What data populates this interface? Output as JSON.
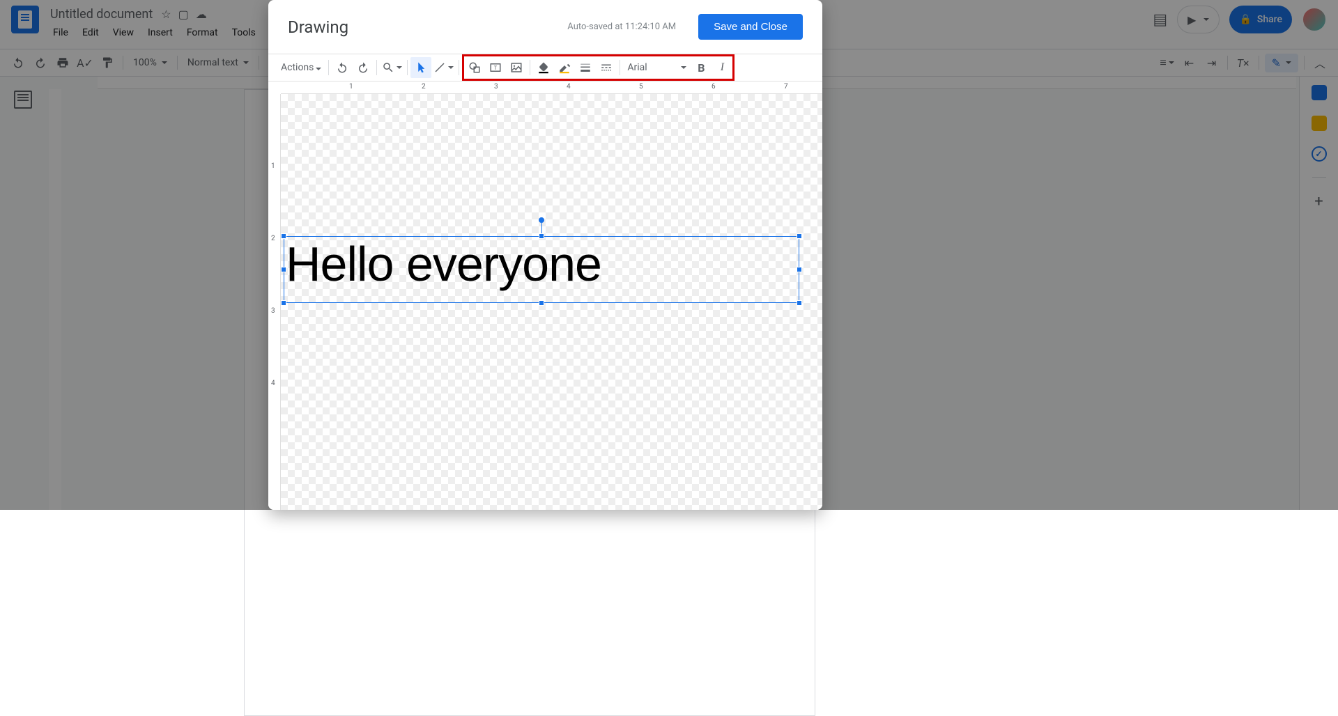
{
  "docs": {
    "title": "Untitled document",
    "menus": [
      "File",
      "Edit",
      "View",
      "Insert",
      "Format",
      "Tools"
    ],
    "zoom": "100%",
    "style_name": "Normal text",
    "share_label": "Share"
  },
  "drawing": {
    "title": "Drawing",
    "saved_status": "Auto-saved at 11:24:10 AM",
    "save_button": "Save and Close",
    "actions_label": "Actions",
    "font": "Arial",
    "canvas_text": "Hello everyone",
    "ruler_h": [
      "1",
      "2",
      "3",
      "4",
      "5",
      "6",
      "7"
    ],
    "ruler_v": [
      "1",
      "2",
      "3",
      "4"
    ]
  }
}
